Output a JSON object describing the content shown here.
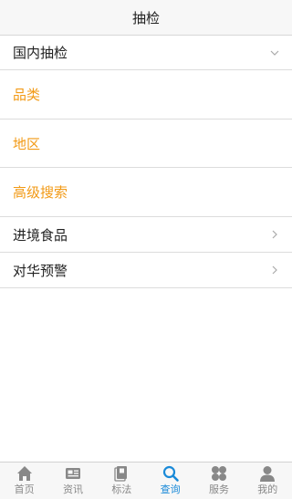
{
  "header": {
    "title": "抽检"
  },
  "list": {
    "domestic": {
      "label": "国内抽检",
      "icon": "chevron-down-icon"
    },
    "category": {
      "label": "品类"
    },
    "region": {
      "label": "地区"
    },
    "advanced_search": {
      "label": "高级搜索"
    },
    "import_food": {
      "label": "进境食品",
      "icon": "chevron-right-icon"
    },
    "china_alert": {
      "label": "对华预警",
      "icon": "chevron-right-icon"
    }
  },
  "tabbar": {
    "tabs": [
      {
        "label": "首页",
        "icon": "home-icon"
      },
      {
        "label": "资讯",
        "icon": "news-icon"
      },
      {
        "label": "标法",
        "icon": "standards-icon"
      },
      {
        "label": "查询",
        "icon": "search-icon"
      },
      {
        "label": "服务",
        "icon": "services-icon"
      },
      {
        "label": "我的",
        "icon": "profile-icon"
      }
    ],
    "active_index": 3
  },
  "colors": {
    "accent_orange": "#f29a16",
    "active_blue": "#1a8ad8",
    "inactive_gray": "#888888"
  }
}
